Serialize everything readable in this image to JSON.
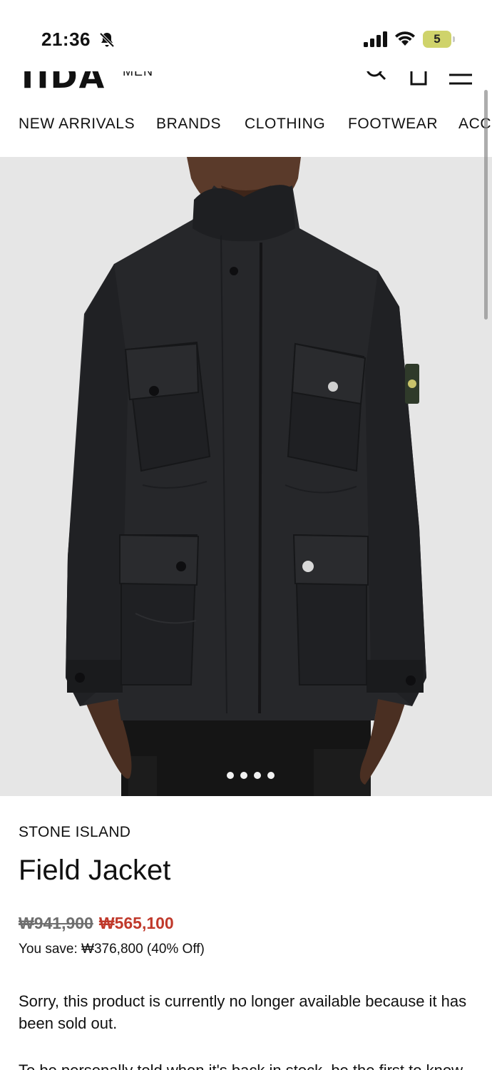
{
  "status_bar": {
    "time": "21:36",
    "battery_level": "5",
    "battery_color": "#cfd36b"
  },
  "header": {
    "logo_text": "ПDA",
    "gender_label": "MEN",
    "icons": [
      "search-icon",
      "bag-icon",
      "menu-icon"
    ]
  },
  "nav": {
    "items": [
      {
        "label": "NEW ARRIVALS"
      },
      {
        "label": "BRANDS"
      },
      {
        "label": "CLOTHING"
      },
      {
        "label": "FOOTWEAR"
      },
      {
        "label": "ACC"
      }
    ]
  },
  "product": {
    "image_dots_count": 4,
    "brand": "STONE ISLAND",
    "title": "Field Jacket",
    "old_price": "₩941,900",
    "new_price": "₩565,100",
    "savings": "You save: ₩376,800 (40% Off)",
    "sold_out_message": "Sorry, this product is currently no longer available because it has been sold out.",
    "next_paragraph": "To be personally told when it's back in stock, be the first to know"
  },
  "colors": {
    "sale_red": "#c0392b",
    "image_bg": "#e6e6e6",
    "jacket": "#26272a"
  }
}
